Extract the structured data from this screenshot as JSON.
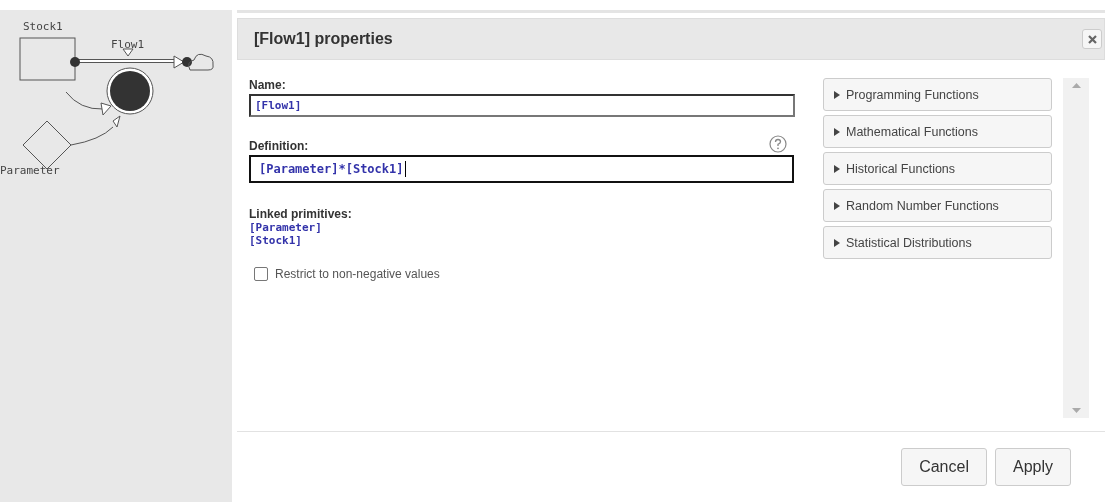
{
  "diagram": {
    "stock": "Stock1",
    "flow": "Flow1",
    "parameter": "Parameter"
  },
  "dialog": {
    "title": "[Flow1] properties",
    "name_label": "Name:",
    "name_value": "[Flow1]",
    "definition_label": "Definition:",
    "definition_value": "[Parameter]*[Stock1]",
    "linked_label": "Linked primitives:",
    "linked": [
      "[Parameter]",
      "[Stock1]"
    ],
    "restrict": {
      "label": "Restrict to non-negative values",
      "checked": false
    },
    "function_groups": [
      {
        "label": "Programming Functions",
        "expanded": false
      },
      {
        "label": "Mathematical Functions",
        "expanded": false
      },
      {
        "label": "Historical Functions",
        "expanded": false
      },
      {
        "label": "Random Number Functions",
        "expanded": false
      },
      {
        "label": "Statistical Distributions",
        "expanded": false
      }
    ],
    "buttons": [
      "Cancel",
      "Apply"
    ]
  }
}
